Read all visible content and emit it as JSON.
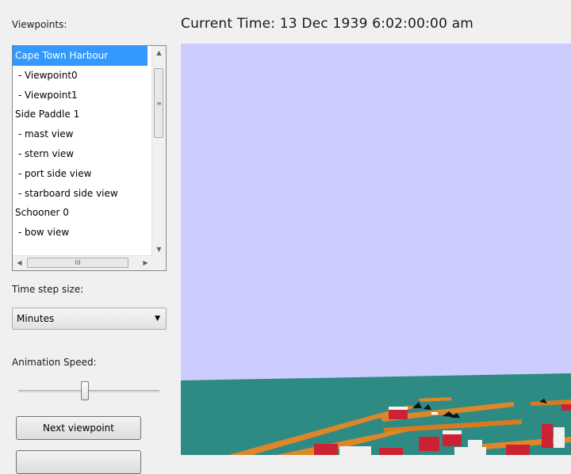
{
  "viewpoints_panel": {
    "label": "Viewpoints:",
    "items": [
      {
        "label": "Cape Town Harbour",
        "selected": true
      },
      {
        "label": " - Viewpoint0"
      },
      {
        "label": " - Viewpoint1"
      },
      {
        "label": "Side Paddle 1"
      },
      {
        "label": " - mast view"
      },
      {
        "label": " - stern view"
      },
      {
        "label": " - port side view"
      },
      {
        "label": " - starboard side view"
      },
      {
        "label": "Schooner 0"
      },
      {
        "label": " - bow view"
      }
    ]
  },
  "time_step": {
    "label": "Time step size:",
    "selected": "Minutes"
  },
  "animation_speed": {
    "label": "Animation Speed:",
    "level": 0.47
  },
  "buttons": {
    "next_viewpoint": "Next viewpoint",
    "second": ""
  },
  "header": {
    "current_time": "Current Time:  13 Dec 1939  6:02:00:00 am"
  },
  "scene": {
    "sky_color": "#ccccff",
    "sea_color": "#2e8b84",
    "wharf_color": "#e0862a",
    "building_color": "#cc2233"
  }
}
